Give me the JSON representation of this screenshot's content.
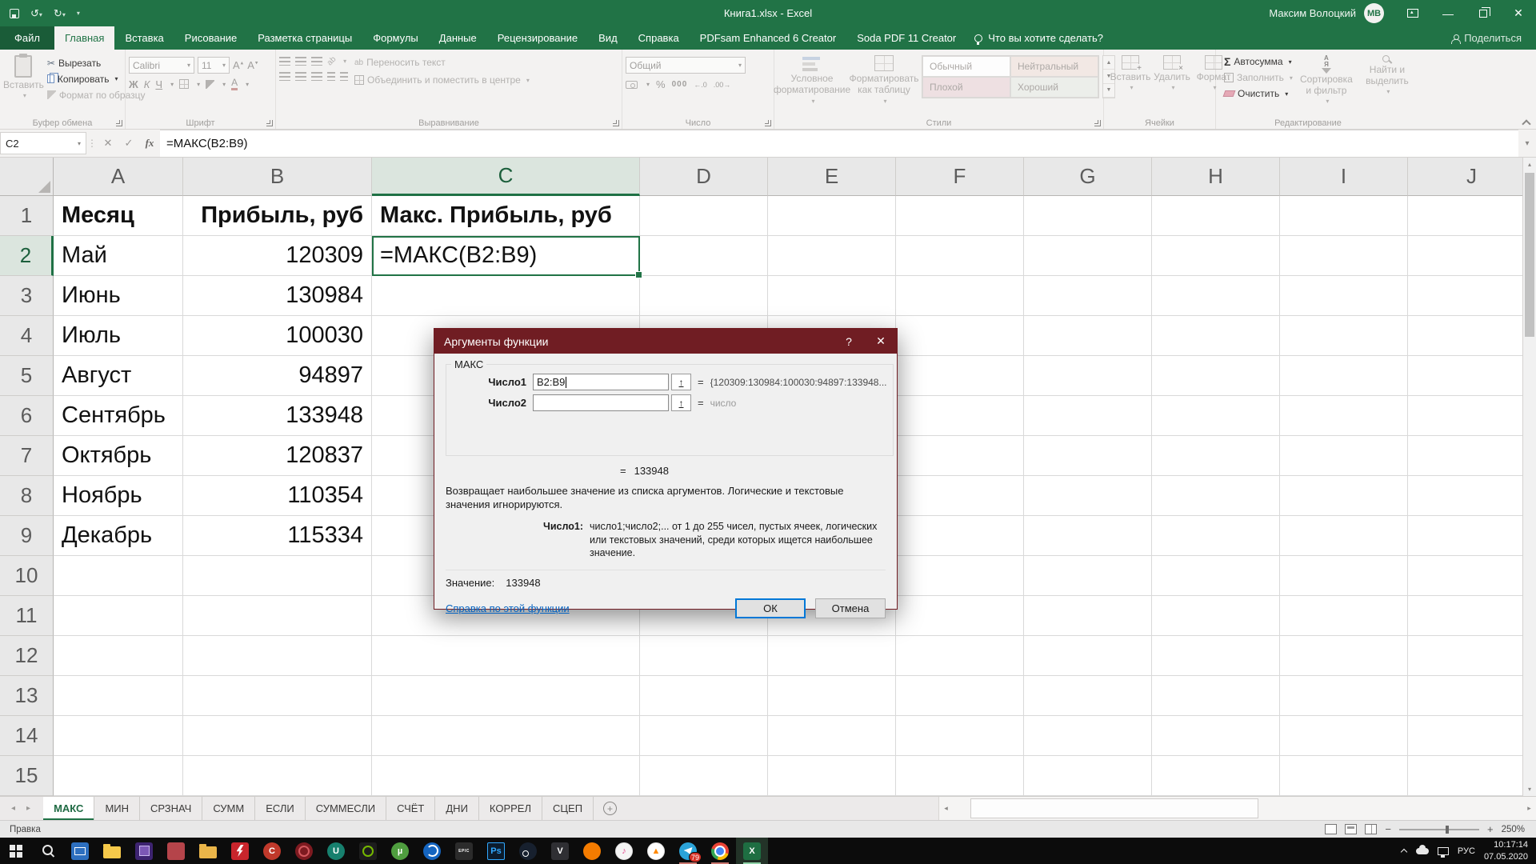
{
  "titlebar": {
    "title": "Книга1.xlsx - Excel",
    "user": "Максим Волоцкий",
    "initials": "МВ"
  },
  "menu": {
    "tabs": [
      "Файл",
      "Главная",
      "Вставка",
      "Рисование",
      "Разметка страницы",
      "Формулы",
      "Данные",
      "Рецензирование",
      "Вид",
      "Справка",
      "PDFsam Enhanced 6 Creator",
      "Soda PDF 11 Creator"
    ],
    "active_tab": "Главная",
    "tell_me": "Что вы хотите сделать?",
    "share": "Поделиться"
  },
  "ribbon": {
    "clipboard": {
      "label": "Буфер обмена",
      "paste": "Вставить",
      "cut": "Вырезать",
      "copy": "Копировать",
      "format_painter": "Формат по образцу"
    },
    "font": {
      "label": "Шрифт",
      "family": "Calibri",
      "size": "11",
      "bold": "Ж",
      "italic": "К",
      "underline": "Ч",
      "grow": "А",
      "shrink": "А",
      "color_letter": "А"
    },
    "alignment": {
      "label": "Выравнивание",
      "wrap": "Переносить текст",
      "merge": "Объединить и поместить в центре"
    },
    "number": {
      "label": "Число",
      "format": "Общий",
      "percent": "%",
      "thousands": "000"
    },
    "styles": {
      "label": "Стили",
      "conditional": "Условное форматирование",
      "format_table": "Форматировать как таблицу",
      "gallery": [
        "Обычный",
        "Нейтральный",
        "Плохой",
        "Хороший"
      ],
      "gallery_bg": [
        "#fdfdfd",
        "#f2e8e4",
        "#eee0e2",
        "#eceeea"
      ]
    },
    "cells": {
      "label": "Ячейки",
      "insert": "Вставить",
      "delete": "Удалить",
      "format": "Формат"
    },
    "editing": {
      "label": "Редактирование",
      "autosum": "Автосумма",
      "fill": "Заполнить",
      "clear": "Очистить",
      "sort": "Сортировка и фильтр",
      "find": "Найти и выделить"
    }
  },
  "formula_bar": {
    "name_box": "C2",
    "formula": "=МАКС(B2:B9)"
  },
  "grid": {
    "col_letters": [
      "A",
      "B",
      "C",
      "D",
      "E",
      "F",
      "G",
      "H",
      "I",
      "J"
    ],
    "row_count": 15,
    "selected": "C2",
    "cells": {
      "A1": "Месяц",
      "B1": "Прибыль, руб",
      "C1": "Макс. Прибыль, руб",
      "A2": "Май",
      "B2": "120309",
      "C2": "=МАКС(B2:B9)",
      "A3": "Июнь",
      "B3": "130984",
      "A4": "Июль",
      "B4": "100030",
      "A5": "Август",
      "B5": "94897",
      "A6": "Сентябрь",
      "B6": "133948",
      "A7": "Октябрь",
      "B7": "120837",
      "A8": "Ноябрь",
      "B8": "110354",
      "A9": "Декабрь",
      "B9": "115334"
    }
  },
  "dialog": {
    "title": "Аргументы функции",
    "function_name": "МАКС",
    "eq": "=",
    "arg1_label": "Число1",
    "arg1_value": "B2:B9",
    "arg1_result": "{120309:130984:100030:94897:133948...",
    "arg2_label": "Число2",
    "arg2_result": "число",
    "result": "133948",
    "description": "Возвращает наибольшее значение из списка аргументов. Логические и текстовые значения игнорируются.",
    "arg_help_label": "Число1:",
    "arg_help": "число1;число2;... от 1 до 255 чисел, пустых ячеек, логических или текстовых значений, среди которых ищется наибольшее значение.",
    "value_label": "Значение:",
    "value": "133948",
    "help_link": "Справка по этой функции",
    "ok": "ОК",
    "cancel": "Отмена"
  },
  "sheet_tabs": {
    "tabs": [
      "МАКС",
      "МИН",
      "СРЗНАЧ",
      "СУММ",
      "ЕСЛИ",
      "СУММЕСЛИ",
      "СЧЁТ",
      "ДНИ",
      "КОРРЕЛ",
      "СЦЕП"
    ],
    "active": "МАКС"
  },
  "status_bar": {
    "mode": "Правка",
    "zoom": "250%"
  },
  "taskbar": {
    "lang": "РУС",
    "time": "10:17:14",
    "date": "07.05.2020",
    "icons": [
      {
        "name": "start",
        "shape": "win"
      },
      {
        "name": "search",
        "shape": "search"
      },
      {
        "name": "mail-app",
        "shape": "square",
        "color": "#2d6fbf"
      },
      {
        "name": "file-explorer",
        "shape": "folder",
        "color": "#f6c94a"
      },
      {
        "name": "cpu-z",
        "shape": "square",
        "color": "#3d2370"
      },
      {
        "name": "media-app",
        "shape": "square",
        "color": "#b5444a"
      },
      {
        "name": "folder-tools",
        "shape": "folder",
        "color": "#eab549"
      },
      {
        "name": "lightning-app",
        "shape": "square",
        "color": "#c8252c"
      },
      {
        "name": "ccleaner",
        "shape": "circle",
        "color": "#c0392b",
        "label": "C"
      },
      {
        "name": "red-circle-app",
        "shape": "circle",
        "color": "#7e1a20"
      },
      {
        "name": "uplay",
        "shape": "circle",
        "color": "#17806e",
        "label": "U"
      },
      {
        "name": "nvidia",
        "shape": "square",
        "color": "#1d1d1d"
      },
      {
        "name": "utorrent",
        "shape": "circle",
        "color": "#4f9e3f",
        "label": "µ"
      },
      {
        "name": "blue-swirl-app",
        "shape": "circle",
        "color": "#1565c0"
      },
      {
        "name": "epic-games",
        "shape": "square",
        "color": "#2b2b2b",
        "label": "EPIC"
      },
      {
        "name": "photoshop",
        "shape": "square",
        "color": "#0c1c2c",
        "label": "Ps",
        "label_color": "#31a8ff"
      },
      {
        "name": "steam",
        "shape": "circle",
        "color": "#17202e"
      },
      {
        "name": "vivaldi",
        "shape": "square",
        "color": "#2f2f33",
        "label": "V"
      },
      {
        "name": "firefox",
        "shape": "circle",
        "color": "#f57c00"
      },
      {
        "name": "itunes",
        "shape": "circle",
        "color": "#f5f5f5",
        "label": "♪",
        "label_color": "#e4498f"
      },
      {
        "name": "vlc",
        "shape": "circle",
        "color": "#ffffff",
        "label": "▲",
        "label_color": "#ff8800"
      },
      {
        "name": "telegram",
        "shape": "circle",
        "color": "#2ba3d8",
        "badge": "79",
        "run": true
      },
      {
        "name": "chrome",
        "shape": "chrome",
        "run": true
      },
      {
        "name": "excel",
        "shape": "square",
        "color": "#1e6e42",
        "label": "X",
        "active": true,
        "run": true
      }
    ]
  }
}
